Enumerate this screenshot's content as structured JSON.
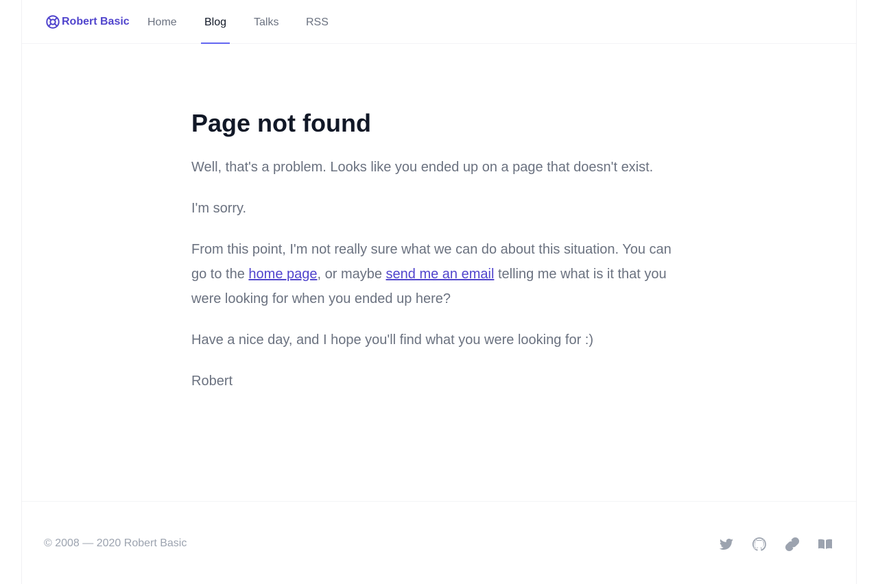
{
  "brand": {
    "name": "Robert Basic",
    "icon": "lifebuoy-icon",
    "color": "#5145cd"
  },
  "nav": {
    "items": [
      {
        "label": "Home"
      },
      {
        "label": "Blog",
        "active": true
      },
      {
        "label": "Talks"
      },
      {
        "label": "RSS"
      }
    ]
  },
  "main": {
    "title": "Page not found",
    "p1": "Well, that's a problem. Looks like you ended up on a page that doesn't exist.",
    "p2": "I'm sorry.",
    "p3": {
      "before": "From this point, I'm not really sure what we can do about this situation. You can go to the ",
      "link1": "home page",
      "middle": ", or maybe ",
      "link2": "send me an email",
      "after": " telling me what is it that you were looking for when you ended up here?"
    },
    "p4": "Have a nice day, and I hope you'll find what you were looking for :)",
    "signature": "Robert"
  },
  "footer": {
    "copyright": "© 2008 — 2020 Robert Basic",
    "social": [
      {
        "icon": "twitter-icon"
      },
      {
        "icon": "github-icon"
      },
      {
        "icon": "link-icon"
      },
      {
        "icon": "book-icon"
      }
    ]
  },
  "colors": {
    "accent": "#6366f1",
    "link": "#5145cd",
    "text": "#6b7280",
    "heading": "#111827",
    "muted": "#9ca3af"
  }
}
